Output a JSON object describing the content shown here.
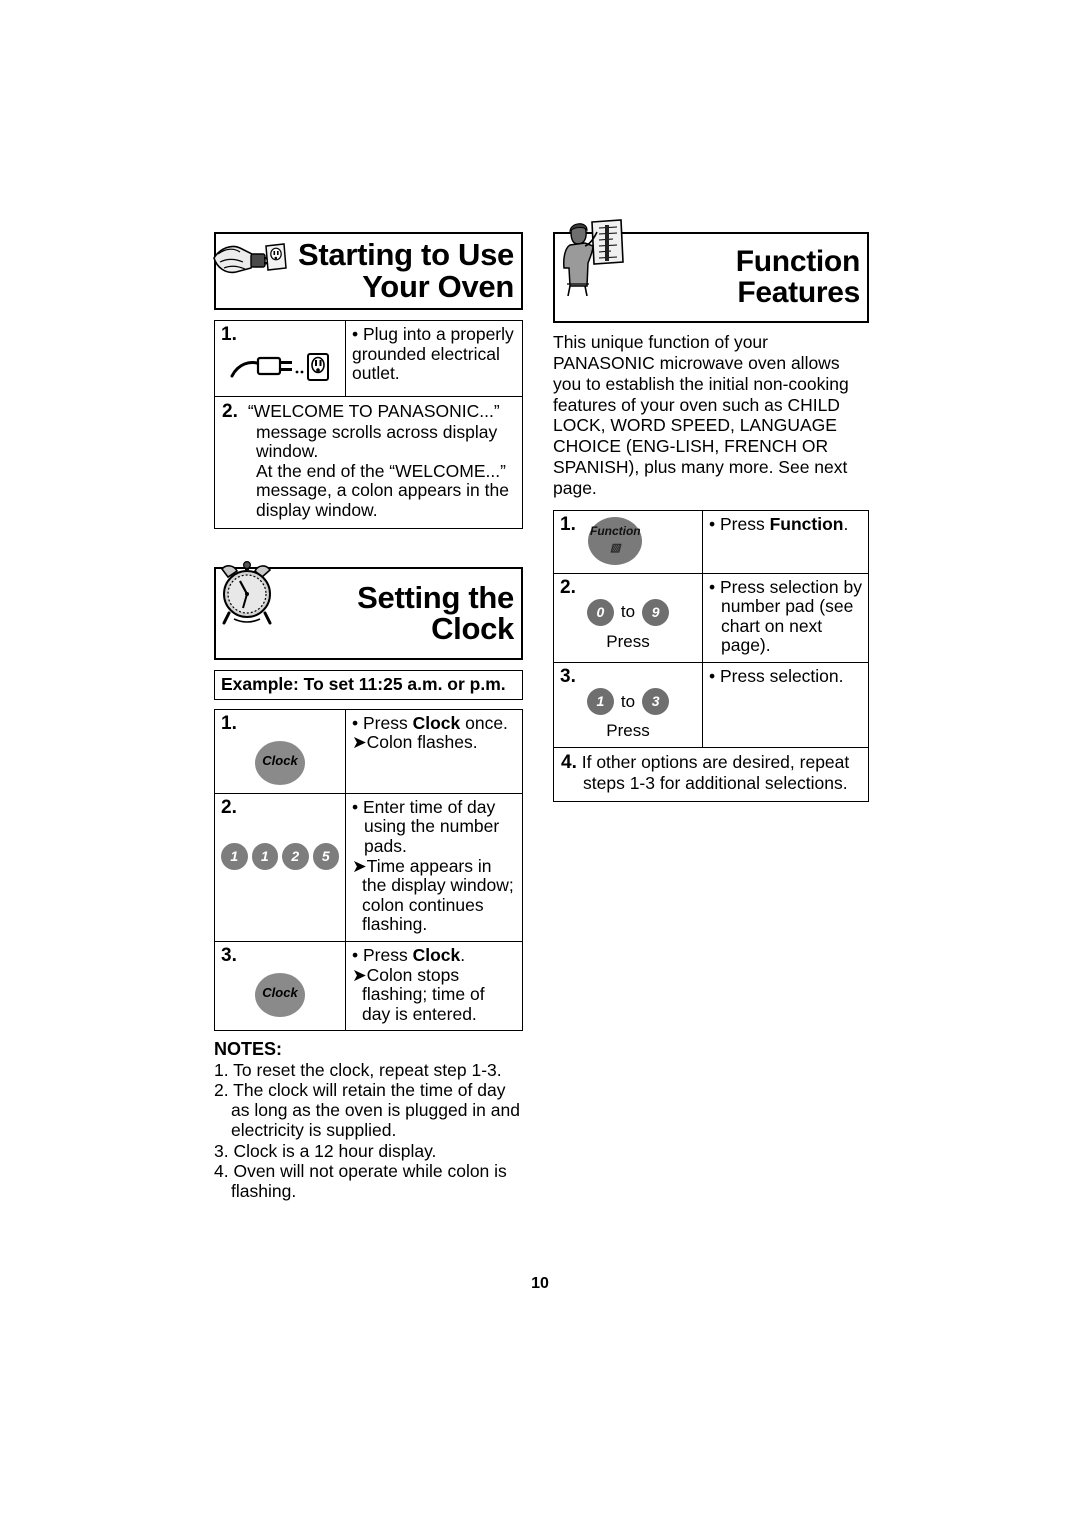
{
  "page": {
    "number": "10"
  },
  "starting_to_use": {
    "icon": "hand-plug-outlet-icon",
    "title": "Starting to Use\nYour Oven",
    "steps": [
      {
        "number": "1.",
        "icon": "plug-and-outlet-icon",
        "text": "• Plug into a properly grounded electrical outlet."
      },
      {
        "number": "2.",
        "line1": "“WELCOME TO PANASONIC...”",
        "line2": "message scrolls across display",
        "line3": "window.",
        "line4": "At the end of the “WELCOME...”",
        "line5": "message, a colon appears in the",
        "line6": "display window."
      }
    ]
  },
  "setting_the_clock": {
    "icon": "alarm-clock-icon",
    "title": "Setting the Clock",
    "example": "Example: To set 11:25 a.m. or p.m.",
    "steps": [
      {
        "number": "1.",
        "button_label": "Clock",
        "bullet": "• Press Clock once.",
        "bullet_pre": "• Press ",
        "bullet_bold": "Clock",
        "bullet_post": " once.",
        "arrow": "➤Colon flashes."
      },
      {
        "number": "2.",
        "pads": [
          "1",
          "1",
          "2",
          "5"
        ],
        "bullet": "• Enter time of day using the number pads.",
        "arrow": "➤Time appears in the display window; colon continues flashing."
      },
      {
        "number": "3.",
        "button_label": "Clock",
        "bullet_pre": "• Press ",
        "bullet_bold": "Clock",
        "bullet_post": ".",
        "arrow": "➤Colon stops flashing; time of day is entered."
      }
    ],
    "notes_title": "NOTES:",
    "notes": [
      "1. To reset the clock, repeat step 1-3.",
      "2. The clock will retain the time of day as long as the oven is plugged in and electricity is supplied.",
      "3. Clock is a 12 hour display.",
      "4. Oven will not operate while colon is flashing."
    ]
  },
  "function_features": {
    "icon": "person-with-chart-icon",
    "title": "Function Features",
    "intro": "This unique function of your PANASONIC microwave oven allows you to establish the initial non-cooking features of your oven such as CHILD LOCK, WORD SPEED, LANGUAGE CHOICE (ENG-LISH, FRENCH OR SPANISH), plus many more. See next page.",
    "steps": [
      {
        "number": "1.",
        "button_label": "Function",
        "button_sub": "▧",
        "bullet_pre": "• Press ",
        "bullet_bold": "Function",
        "bullet_post": "."
      },
      {
        "number": "2.",
        "pad_from": "0",
        "to_word": "to",
        "pad_to": "9",
        "press_word": "Press",
        "bullet": "• Press selection by number pad (see chart on next page)."
      },
      {
        "number": "3.",
        "pad_from": "1",
        "to_word": "to",
        "pad_to": "3",
        "press_word": "Press",
        "bullet": "• Press selection."
      }
    ],
    "step4_number": "4.",
    "step4_text": "If other options are desired, repeat steps 1-3 for additional selections."
  },
  "colors": {
    "button_gray": "#7d7d7d",
    "text_black": "#000000",
    "background": "#ffffff"
  }
}
